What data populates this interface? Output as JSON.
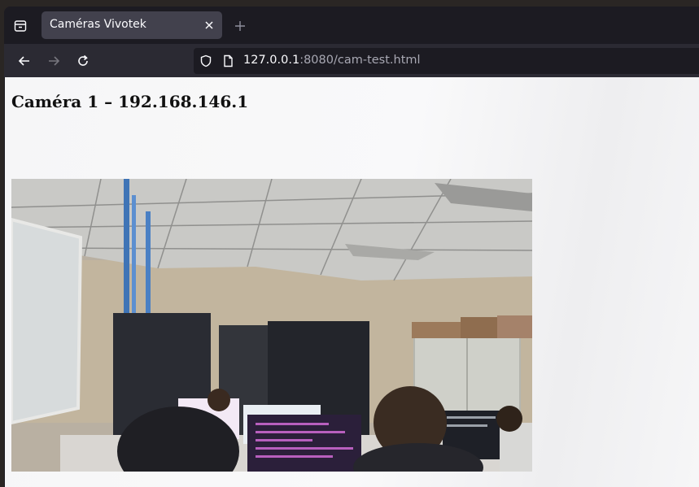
{
  "browser": {
    "tab": {
      "title": "Caméras Vivotek",
      "close_icon": "close-icon"
    },
    "new_tab_icon": "plus-icon",
    "tab_list_icon": "tab-list-icon",
    "nav": {
      "back_icon": "arrow-left-icon",
      "forward_icon": "arrow-right-icon",
      "reload_icon": "reload-icon"
    },
    "url": {
      "host": "127.0.0.1",
      "rest": ":8080/cam-test.html",
      "shield_icon": "shield-icon",
      "page_icon": "page-icon"
    }
  },
  "page": {
    "title": "Caméra 1 – 192.168.146.1"
  },
  "colors": {
    "tab_bar": "#1c1b22",
    "active_tab": "#42414d",
    "nav_bar": "#2b2a33",
    "page_background": "#f7f7f8"
  }
}
